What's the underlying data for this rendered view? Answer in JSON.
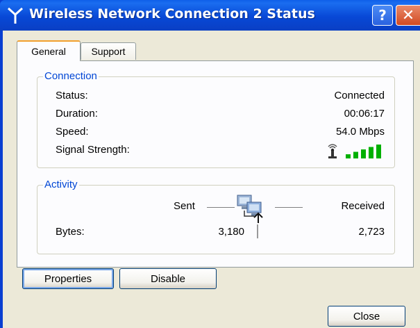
{
  "window": {
    "title": "Wireless Network Connection 2 Status",
    "icon": "wireless-antenna-icon",
    "help_label": "?",
    "close_label": "✕"
  },
  "tabs": [
    {
      "label": "General",
      "active": true
    },
    {
      "label": "Support",
      "active": false
    }
  ],
  "connection": {
    "legend": "Connection",
    "status_label": "Status:",
    "status_value": "Connected",
    "duration_label": "Duration:",
    "duration_value": "00:06:17",
    "speed_label": "Speed:",
    "speed_value": "54.0 Mbps",
    "signal_label": "Signal Strength:",
    "signal_bars_lit": 5,
    "signal_bars_total": 5,
    "signal_color": "#00b000"
  },
  "activity": {
    "legend": "Activity",
    "sent_label": "Sent",
    "received_label": "Received",
    "bytes_label": "Bytes:",
    "bytes_sent": "3,180",
    "bytes_received": "2,723",
    "icon": "network-computers-icon"
  },
  "buttons": {
    "properties": "Properties",
    "disable": "Disable",
    "close": "Close"
  },
  "colors": {
    "titlebar": "#0a3fd1",
    "legend_text": "#0046d5",
    "dialog_bg": "#ece9d8",
    "tab_highlight": "#f2a02e"
  }
}
